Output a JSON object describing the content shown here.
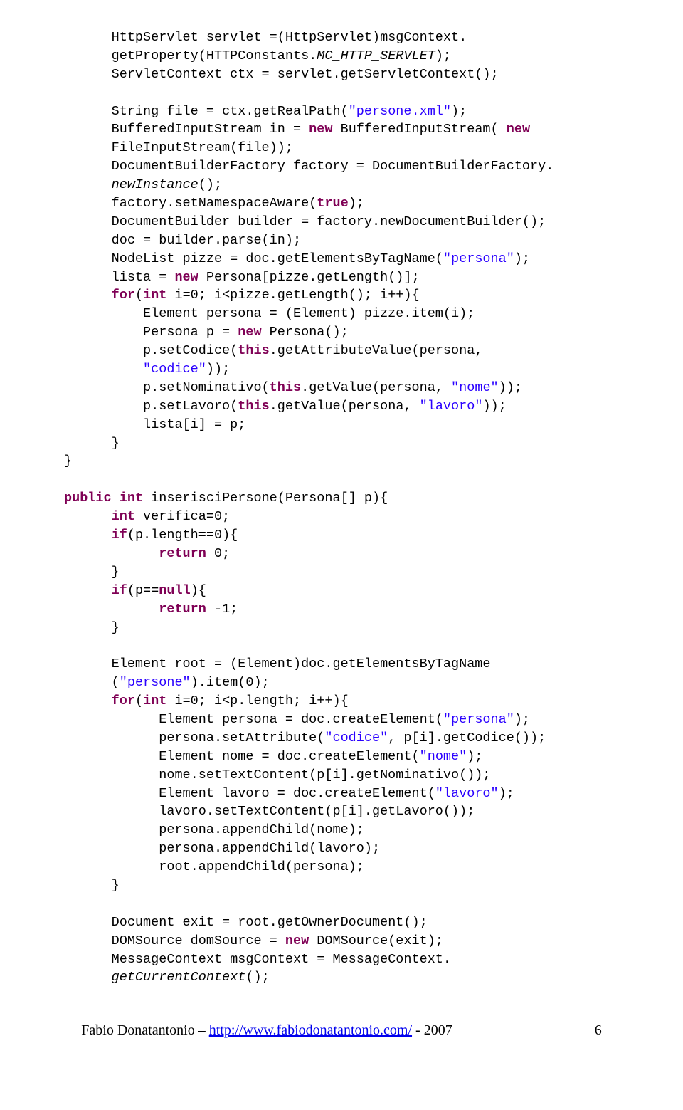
{
  "code": {
    "t1": "      HttpServlet servlet =(HttpServlet)msgContext.\n",
    "t2a": "      getProperty(HTTPConstants.",
    "t2b": "MC_HTTP_SERVLET",
    "t2c": ");\n",
    "t3": "      ServletContext ctx = servlet.getServletContext();\n\n",
    "t4a": "      String file = ctx.getRealPath(",
    "t4b": "\"persone.xml\"",
    "t4c": ");\n",
    "t5a": "      BufferedInputStream in = ",
    "t5b": "new",
    "t5c": " BufferedInputStream( ",
    "t5d": "new",
    "t5e": "\n      FileInputStream(file));\n",
    "t6": "      DocumentBuilderFactory factory = DocumentBuilderFactory.\n",
    "t7a": "      ",
    "t7b": "newInstance",
    "t7c": "();\n",
    "t8a": "      factory.setNamespaceAware(",
    "t8b": "true",
    "t8c": ");\n",
    "t9": "      DocumentBuilder builder = factory.newDocumentBuilder();\n",
    "t10": "      doc = builder.parse(in);\n",
    "t11a": "      NodeList pizze = doc.getElementsByTagName(",
    "t11b": "\"persona\"",
    "t11c": ");\n",
    "t12a": "      lista = ",
    "t12b": "new",
    "t12c": " Persona[pizze.getLength()];\n",
    "t13a": "      ",
    "t13b": "for",
    "t13c": "(",
    "t13d": "int",
    "t13e": " i=0; i<pizze.getLength(); i++){\n",
    "t14": "          Element persona = (Element) pizze.item(i);\n",
    "t15a": "          Persona p = ",
    "t15b": "new",
    "t15c": " Persona();\n",
    "t16a": "          p.setCodice(",
    "t16b": "this",
    "t16c": ".getAttributeValue(persona,\n",
    "t17a": "          ",
    "t17b": "\"codice\"",
    "t17c": "));\n",
    "t18a": "          p.setNominativo(",
    "t18b": "this",
    "t18c": ".getValue(persona, ",
    "t18d": "\"nome\"",
    "t18e": "));\n",
    "t19a": "          p.setLavoro(",
    "t19b": "this",
    "t19c": ".getValue(persona, ",
    "t19d": "\"lavoro\"",
    "t19e": "));\n",
    "t20": "          lista[i] = p;\n",
    "t21": "      }\n}\n\n",
    "m1a": "public",
    "m1b": " ",
    "m1c": "int",
    "m1d": " inserisciPersone(Persona[] p){\n",
    "m2a": "      ",
    "m2b": "int",
    "m2c": " verifica=0;\n",
    "m3a": "      ",
    "m3b": "if",
    "m3c": "(p.length==0){\n",
    "m4a": "            ",
    "m4b": "return",
    "m4c": " 0;\n",
    "m5": "      }\n",
    "m6a": "      ",
    "m6b": "if",
    "m6c": "(p==",
    "m6d": "null",
    "m6e": "){\n",
    "m7a": "            ",
    "m7b": "return",
    "m7c": " -1;\n",
    "m8": "      }\n\n",
    "m9": "      Element root = (Element)doc.getElementsByTagName\n",
    "m10a": "      (",
    "m10b": "\"persone\"",
    "m10c": ").item(0);\n",
    "m11a": "      ",
    "m11b": "for",
    "m11c": "(",
    "m11d": "int",
    "m11e": " i=0; i<p.length; i++){\n",
    "m12a": "            Element persona = doc.createElement(",
    "m12b": "\"persona\"",
    "m12c": ");\n",
    "m13a": "            persona.setAttribute(",
    "m13b": "\"codice\"",
    "m13c": ", p[i].getCodice());\n",
    "m14a": "            Element nome = doc.createElement(",
    "m14b": "\"nome\"",
    "m14c": ");\n",
    "m15": "            nome.setTextContent(p[i].getNominativo());\n",
    "m16a": "            Element lavoro = doc.createElement(",
    "m16b": "\"lavoro\"",
    "m16c": ");\n",
    "m17": "            lavoro.setTextContent(p[i].getLavoro());\n",
    "m18": "            persona.appendChild(nome);\n",
    "m19": "            persona.appendChild(lavoro);\n",
    "m20": "            root.appendChild(persona);\n",
    "m21": "      }\n\n",
    "m22": "      Document exit = root.getOwnerDocument();\n",
    "m23a": "      DOMSource domSource = ",
    "m23b": "new",
    "m23c": " DOMSource(exit);\n",
    "m24": "      MessageContext msgContext = MessageContext.\n",
    "m25a": "      ",
    "m25b": "getCurrentContext",
    "m25c": "();\n"
  },
  "footer": {
    "author": "Fabio Donatantonio – ",
    "url": "http://www.fabiodonatantonio.com/",
    "suffix": " - 2007",
    "pagenum": "6"
  }
}
